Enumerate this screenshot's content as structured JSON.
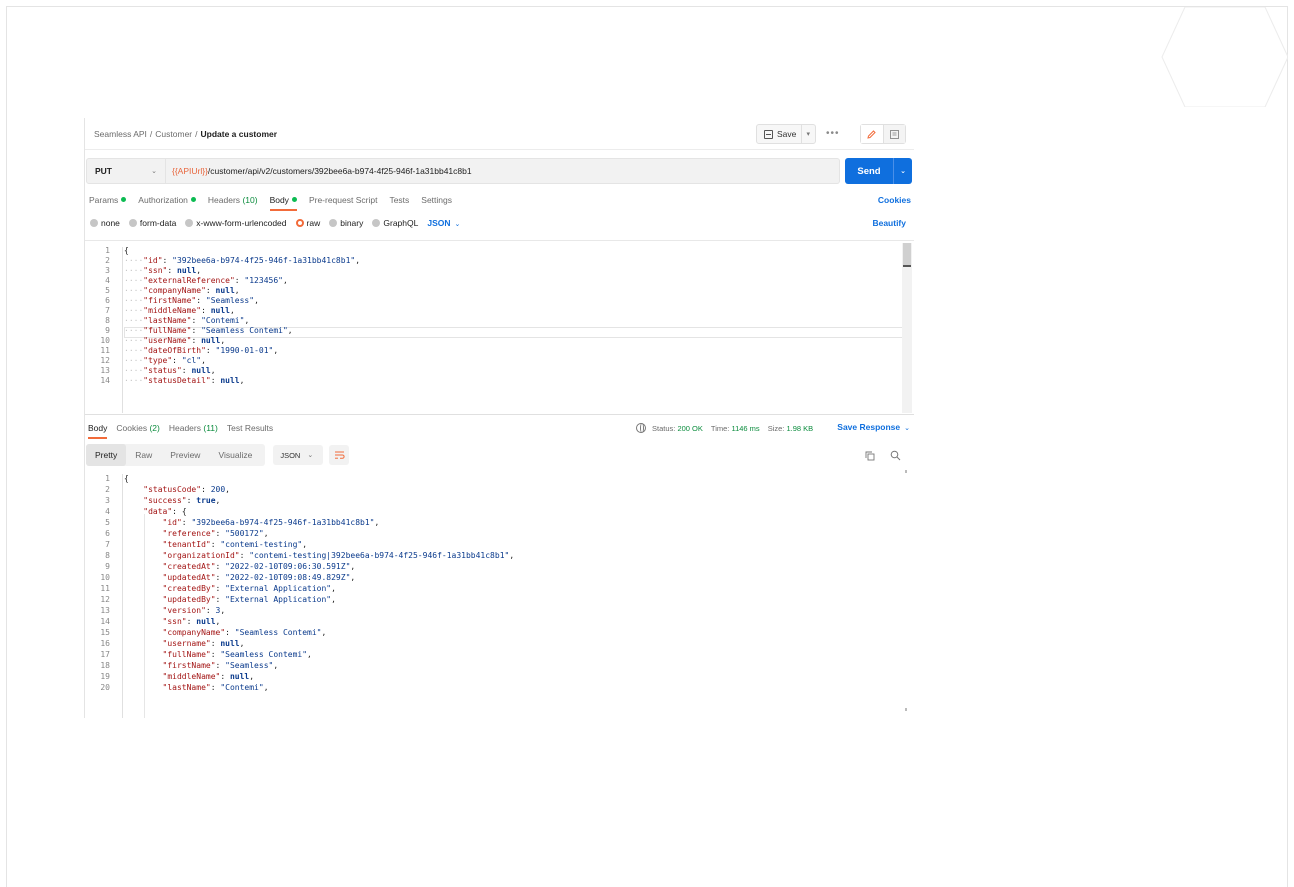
{
  "breadcrumb": {
    "items": [
      "Seamless API",
      "Customer"
    ],
    "current": "Update a customer"
  },
  "toolbar": {
    "save_label": "Save",
    "more_label": "•••"
  },
  "request": {
    "method": "PUT",
    "url_variable": "{{APIUrl}}",
    "url_path": "/customer/api/v2/customers/392bee6a-b974-4f25-946f-1a31bb41c8b1",
    "send_label": "Send"
  },
  "request_tabs": {
    "params": "Params",
    "authorization": "Authorization",
    "headers": "Headers",
    "headers_count": "(10)",
    "body": "Body",
    "prerequest": "Pre-request Script",
    "tests": "Tests",
    "settings": "Settings",
    "cookies": "Cookies"
  },
  "body_types": {
    "none": "none",
    "form_data": "form-data",
    "urlencoded": "x-www-form-urlencoded",
    "raw": "raw",
    "binary": "binary",
    "graphql": "GraphQL",
    "format": "JSON",
    "beautify": "Beautify"
  },
  "request_body": [
    {
      "n": "1",
      "t": "{"
    },
    {
      "n": "2",
      "k": "\"id\"",
      "v": "\"392bee6a-b974-4f25-946f-1a31bb41c8b1\"",
      "vt": "s"
    },
    {
      "n": "3",
      "k": "\"ssn\"",
      "v": "null",
      "vt": "kw"
    },
    {
      "n": "4",
      "k": "\"externalReference\"",
      "v": "\"123456\"",
      "vt": "s"
    },
    {
      "n": "5",
      "k": "\"companyName\"",
      "v": "null",
      "vt": "kw"
    },
    {
      "n": "6",
      "k": "\"firstName\"",
      "v": "\"Seamless\"",
      "vt": "s"
    },
    {
      "n": "7",
      "k": "\"middleName\"",
      "v": "null",
      "vt": "kw"
    },
    {
      "n": "8",
      "k": "\"lastName\"",
      "v": "\"Contemi\"",
      "vt": "s"
    },
    {
      "n": "9",
      "k": "\"fullName\"",
      "v": "\"Seamless Contemi\"",
      "vt": "s"
    },
    {
      "n": "10",
      "k": "\"userName\"",
      "v": "null",
      "vt": "kw"
    },
    {
      "n": "11",
      "k": "\"dateOfBirth\"",
      "v": "\"1990-01-01\"",
      "vt": "s"
    },
    {
      "n": "12",
      "k": "\"type\"",
      "v": "\"cl\"",
      "vt": "s"
    },
    {
      "n": "13",
      "k": "\"status\"",
      "v": "null",
      "vt": "kw"
    },
    {
      "n": "14",
      "k": "\"statusDetail\"",
      "v": "null",
      "vt": "kw"
    }
  ],
  "response_tabs": {
    "body": "Body",
    "cookies": "Cookies",
    "cookies_count": "(2)",
    "headers": "Headers",
    "headers_count": "(11)",
    "test_results": "Test Results"
  },
  "response_meta": {
    "status_label": "Status:",
    "status_value": "200 OK",
    "time_label": "Time:",
    "time_value": "1146 ms",
    "size_label": "Size:",
    "size_value": "1.98 KB",
    "save_response": "Save Response"
  },
  "response_view": {
    "pretty": "Pretty",
    "raw": "Raw",
    "preview": "Preview",
    "visualize": "Visualize",
    "format": "JSON"
  },
  "response_body": [
    {
      "n": "1",
      "t": "{",
      "i": 0
    },
    {
      "n": "2",
      "k": "\"statusCode\"",
      "v": "200",
      "vt": "n",
      "i": 1
    },
    {
      "n": "3",
      "k": "\"success\"",
      "v": "true",
      "vt": "kw",
      "i": 1
    },
    {
      "n": "4",
      "k": "\"data\"",
      "v": "{",
      "vt": "p",
      "i": 1,
      "open": true
    },
    {
      "n": "5",
      "k": "\"id\"",
      "v": "\"392bee6a-b974-4f25-946f-1a31bb41c8b1\"",
      "vt": "s",
      "i": 2
    },
    {
      "n": "6",
      "k": "\"reference\"",
      "v": "\"500172\"",
      "vt": "s",
      "i": 2
    },
    {
      "n": "7",
      "k": "\"tenantId\"",
      "v": "\"contemi-testing\"",
      "vt": "s",
      "i": 2
    },
    {
      "n": "8",
      "k": "\"organizationId\"",
      "v": "\"contemi-testing|392bee6a-b974-4f25-946f-1a31bb41c8b1\"",
      "vt": "s",
      "i": 2
    },
    {
      "n": "9",
      "k": "\"createdAt\"",
      "v": "\"2022-02-10T09:06:30.591Z\"",
      "vt": "s",
      "i": 2
    },
    {
      "n": "10",
      "k": "\"updatedAt\"",
      "v": "\"2022-02-10T09:08:49.829Z\"",
      "vt": "s",
      "i": 2
    },
    {
      "n": "11",
      "k": "\"createdBy\"",
      "v": "\"External Application\"",
      "vt": "s",
      "i": 2
    },
    {
      "n": "12",
      "k": "\"updatedBy\"",
      "v": "\"External Application\"",
      "vt": "s",
      "i": 2
    },
    {
      "n": "13",
      "k": "\"version\"",
      "v": "3",
      "vt": "n",
      "i": 2
    },
    {
      "n": "14",
      "k": "\"ssn\"",
      "v": "null",
      "vt": "kw",
      "i": 2
    },
    {
      "n": "15",
      "k": "\"companyName\"",
      "v": "\"Seamless Contemi\"",
      "vt": "s",
      "i": 2
    },
    {
      "n": "16",
      "k": "\"username\"",
      "v": "null",
      "vt": "kw",
      "i": 2
    },
    {
      "n": "17",
      "k": "\"fullName\"",
      "v": "\"Seamless Contemi\"",
      "vt": "s",
      "i": 2
    },
    {
      "n": "18",
      "k": "\"firstName\"",
      "v": "\"Seamless\"",
      "vt": "s",
      "i": 2
    },
    {
      "n": "19",
      "k": "\"middleName\"",
      "v": "null",
      "vt": "kw",
      "i": 2
    },
    {
      "n": "20",
      "k": "\"lastName\"",
      "v": "\"Contemi\"",
      "vt": "s",
      "i": 2
    }
  ],
  "colors": {
    "accent": "#f26b3a",
    "primary": "#0f6fde",
    "success": "#0cbb52"
  },
  "icons": [
    "save-icon",
    "chevron-down-icon",
    "edit-icon",
    "comment-icon",
    "globe-icon",
    "copy-icon",
    "search-icon",
    "wrap-lines-icon"
  ]
}
